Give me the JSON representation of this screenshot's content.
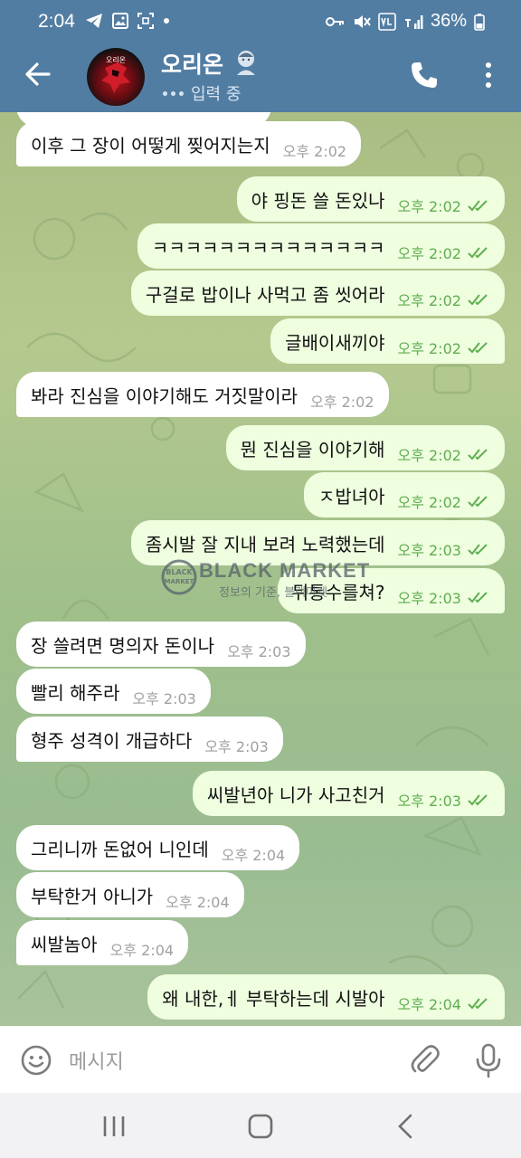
{
  "status_bar": {
    "time": "2:04",
    "battery": "36%"
  },
  "header": {
    "avatar_label": "오리온",
    "contact_name": "오리온",
    "status": "입력 중"
  },
  "watermark": {
    "title": "BLACK MARKET",
    "logo_line1": "BLACK",
    "logo_line2": "MARKET",
    "subtitle": "정보의 기준, 블랙마켓"
  },
  "messages": [
    {
      "dir": "in",
      "text": "이후 그 장이 어떻게 찢어지는지",
      "time": "오후 2:02"
    },
    {
      "dir": "out",
      "text": "야 핑돈 쓸 돈있나",
      "time": "오후 2:02"
    },
    {
      "dir": "out",
      "text": "ㅋㅋㅋㅋㅋㅋㅋㅋㅋㅋㅋㅋㅋㅋ",
      "time": "오후 2:02"
    },
    {
      "dir": "out",
      "text": "구걸로 밥이나 사먹고 좀 씻어라",
      "time": "오후 2:02"
    },
    {
      "dir": "out",
      "text": "글배이새끼야",
      "time": "오후 2:02"
    },
    {
      "dir": "in",
      "text": "봐라 진심을 이야기해도 거짓말이라",
      "time": "오후 2:02"
    },
    {
      "dir": "out",
      "text": "뭔 진심을 이야기해",
      "time": "오후 2:02"
    },
    {
      "dir": "out",
      "text": "ㅈ밥녀아",
      "time": "오후 2:02"
    },
    {
      "dir": "out",
      "text": "좀시발 잘 지내 보려 노력했는데",
      "time": "오후 2:03"
    },
    {
      "dir": "out",
      "text": "뒤통수를쳐?",
      "time": "오후 2:03"
    },
    {
      "dir": "in",
      "text": "장 쓸려면 명의자 돈이나",
      "time": "오후 2:03"
    },
    {
      "dir": "in",
      "text": "빨리 해주라",
      "time": "오후 2:03"
    },
    {
      "dir": "in",
      "text": "형주 성격이 개급하다",
      "time": "오후 2:03"
    },
    {
      "dir": "out",
      "text": "씨발년아 니가 사고친거",
      "time": "오후 2:03"
    },
    {
      "dir": "in",
      "text": "그리니까 돈없어 니인데",
      "time": "오후 2:04"
    },
    {
      "dir": "in",
      "text": "부탁한거 아니가",
      "time": "오후 2:04"
    },
    {
      "dir": "in",
      "text": "씨발놈아",
      "time": "오후 2:04"
    },
    {
      "dir": "out",
      "text": "왜 내한,ㅔ 부탁하는데 시발아",
      "time": "오후 2:04"
    }
  ],
  "input": {
    "placeholder": "메시지"
  }
}
